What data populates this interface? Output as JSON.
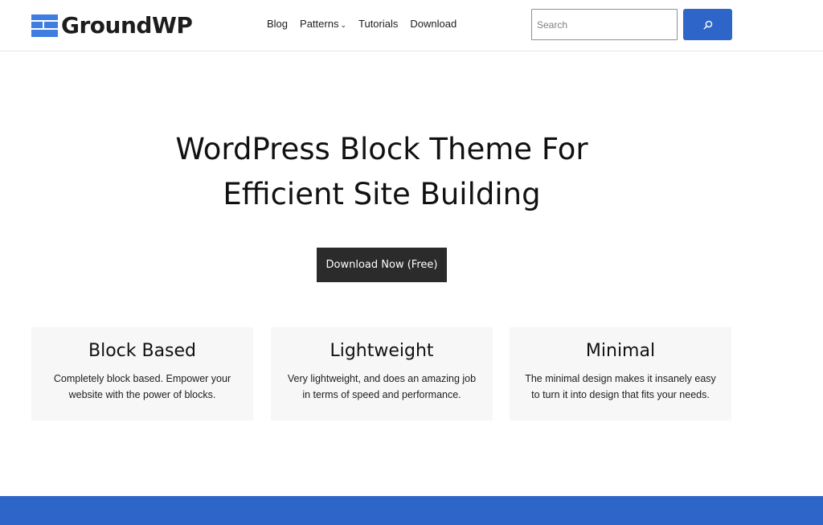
{
  "header": {
    "logo_text": "GroundWP",
    "nav": [
      {
        "label": "Blog"
      },
      {
        "label": "Patterns",
        "has_dropdown": true
      },
      {
        "label": "Tutorials"
      },
      {
        "label": "Download"
      }
    ],
    "search": {
      "placeholder": "Search",
      "button_icon": "search-icon"
    }
  },
  "hero": {
    "title_line1": "WordPress Block Theme For",
    "title_line2": "Efficient Site Building",
    "cta_label": "Download Now (Free)"
  },
  "features": [
    {
      "title": "Block Based",
      "desc_line1": "Completely block based. Empower your",
      "desc_line2": "website with the power of blocks."
    },
    {
      "title": "Lightweight",
      "desc_line1": "Very lightweight, and does an amazing job",
      "desc_line2": "in terms of speed and performance."
    },
    {
      "title": "Minimal",
      "desc_line1": "The minimal design makes it insanely easy",
      "desc_line2": "to turn it into design that fits your needs."
    }
  ],
  "colors": {
    "accent": "#2d66c8",
    "cta_bg": "#2b2b2b",
    "card_bg": "#f7f7f7"
  }
}
